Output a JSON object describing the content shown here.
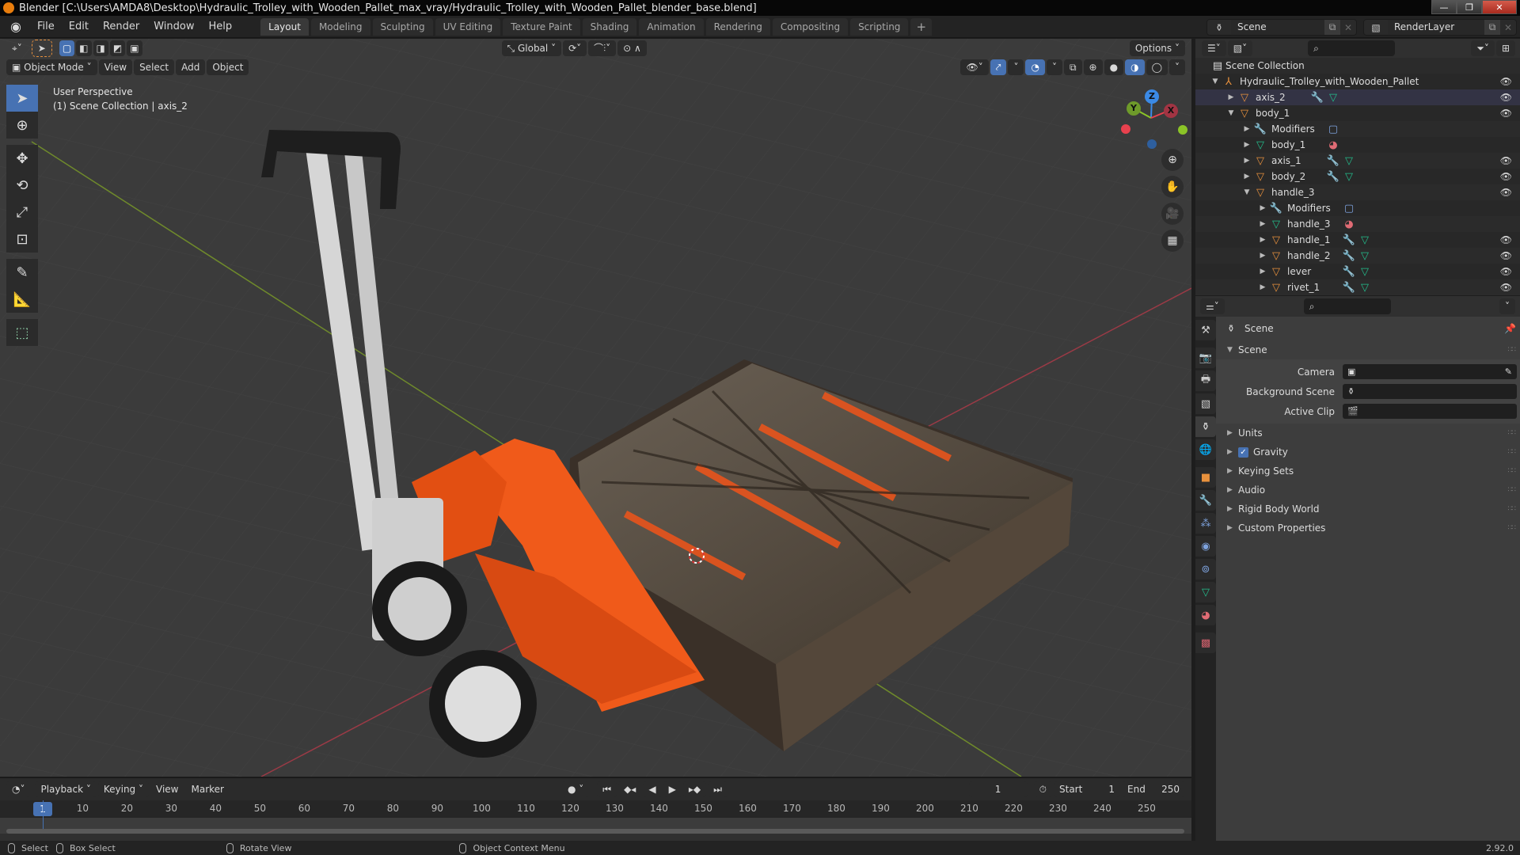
{
  "window": {
    "title": "Blender [C:\\Users\\AMDA8\\Desktop\\Hydraulic_Trolley_with_Wooden_Pallet_max_vray/Hydraulic_Trolley_with_Wooden_Pallet_blender_base.blend]",
    "minimize": "—",
    "restore": "❐",
    "close": "✕"
  },
  "menu": [
    "File",
    "Edit",
    "Render",
    "Window",
    "Help"
  ],
  "workspaces": [
    {
      "label": "Layout",
      "active": true
    },
    {
      "label": "Modeling"
    },
    {
      "label": "Sculpting"
    },
    {
      "label": "UV Editing"
    },
    {
      "label": "Texture Paint"
    },
    {
      "label": "Shading"
    },
    {
      "label": "Animation"
    },
    {
      "label": "Rendering"
    },
    {
      "label": "Compositing"
    },
    {
      "label": "Scripting"
    },
    {
      "label": "+"
    }
  ],
  "scene_selector": {
    "value": "Scene"
  },
  "view_layer_selector": {
    "value": "RenderLayer"
  },
  "viewport": {
    "orientation": "Global",
    "options_label": "Options",
    "mode": "Object Mode",
    "header_menus": [
      "View",
      "Select",
      "Add",
      "Object"
    ],
    "info_line1": "User Perspective",
    "info_line2": "(1) Scene Collection | axis_2",
    "gizmo_axes": {
      "x": "X",
      "y": "Y",
      "z": "Z"
    },
    "colors": {
      "x": "#e8414e",
      "y": "#8bc427",
      "z": "#3b8ae6",
      "accent": "#4772b3"
    },
    "tools": [
      "select-box",
      "cursor",
      "move",
      "rotate",
      "scale",
      "transform",
      "annotate",
      "measure",
      "add-cube"
    ]
  },
  "timeline": {
    "menus": [
      "Playback",
      "Keying",
      "View",
      "Marker"
    ],
    "current_frame": "1",
    "start_label": "Start",
    "start": "1",
    "end_label": "End",
    "end": "250",
    "ticks": [
      "10",
      "20",
      "30",
      "40",
      "50",
      "60",
      "70",
      "80",
      "90",
      "100",
      "110",
      "120",
      "130",
      "140",
      "150",
      "160",
      "170",
      "180",
      "190",
      "200",
      "210",
      "220",
      "230",
      "240",
      "250"
    ]
  },
  "statusbar": {
    "items": [
      "Select",
      "Box Select",
      "Rotate View",
      "Object Context Menu"
    ],
    "version": "2.92.0"
  },
  "outliner": {
    "root": "Scene Collection",
    "rows": [
      {
        "label": "Hydraulic_Trolley_with_Wooden_Pallet",
        "depth": 0,
        "type": "empty",
        "expanded": true,
        "eye": true
      },
      {
        "label": "axis_2",
        "depth": 1,
        "type": "mesh-object",
        "expanded": false,
        "eye": true,
        "mod": true,
        "data": true,
        "active": true
      },
      {
        "label": "body_1",
        "depth": 1,
        "type": "mesh-object",
        "expanded": true,
        "eye": true
      },
      {
        "label": "Modifiers",
        "depth": 2,
        "type": "modifiers",
        "expanded": false,
        "extra": "subsurf"
      },
      {
        "label": "body_1",
        "depth": 2,
        "type": "mesh-data",
        "expanded": false,
        "extra": "material"
      },
      {
        "label": "axis_1",
        "depth": 2,
        "type": "mesh-object",
        "expanded": false,
        "eye": true,
        "mod": true,
        "data": true
      },
      {
        "label": "body_2",
        "depth": 2,
        "type": "mesh-object",
        "expanded": false,
        "eye": true,
        "mod": true,
        "data": true
      },
      {
        "label": "handle_3",
        "depth": 2,
        "type": "mesh-object",
        "expanded": true,
        "eye": true
      },
      {
        "label": "Modifiers",
        "depth": 3,
        "type": "modifiers",
        "expanded": false,
        "extra": "subsurf"
      },
      {
        "label": "handle_3",
        "depth": 3,
        "type": "mesh-data",
        "expanded": false,
        "extra": "material"
      },
      {
        "label": "handle_1",
        "depth": 3,
        "type": "mesh-object",
        "expanded": false,
        "eye": true,
        "mod": true,
        "data": true
      },
      {
        "label": "handle_2",
        "depth": 3,
        "type": "mesh-object",
        "expanded": false,
        "eye": true,
        "mod": true,
        "data": true
      },
      {
        "label": "lever",
        "depth": 3,
        "type": "mesh-object",
        "expanded": false,
        "eye": true,
        "mod": true,
        "data": true
      },
      {
        "label": "rivet_1",
        "depth": 3,
        "type": "mesh-object",
        "expanded": false,
        "eye": true,
        "mod": true,
        "data": true
      }
    ]
  },
  "properties": {
    "context": "Scene",
    "panel_title": "Scene",
    "fields": [
      {
        "label": "Camera",
        "value": ""
      },
      {
        "label": "Background Scene",
        "value": ""
      },
      {
        "label": "Active Clip",
        "value": ""
      }
    ],
    "sections": [
      {
        "label": "Units"
      },
      {
        "label": "Gravity",
        "checkbox": true,
        "checked": true
      },
      {
        "label": "Keying Sets"
      },
      {
        "label": "Audio"
      },
      {
        "label": "Rigid Body World"
      },
      {
        "label": "Custom Properties"
      }
    ],
    "tabs": [
      "tool",
      "render",
      "output",
      "view-layer",
      "scene",
      "world",
      "object",
      "modifiers",
      "particles",
      "physics",
      "constraints",
      "data",
      "material",
      "texture"
    ],
    "active_tab": "scene"
  }
}
